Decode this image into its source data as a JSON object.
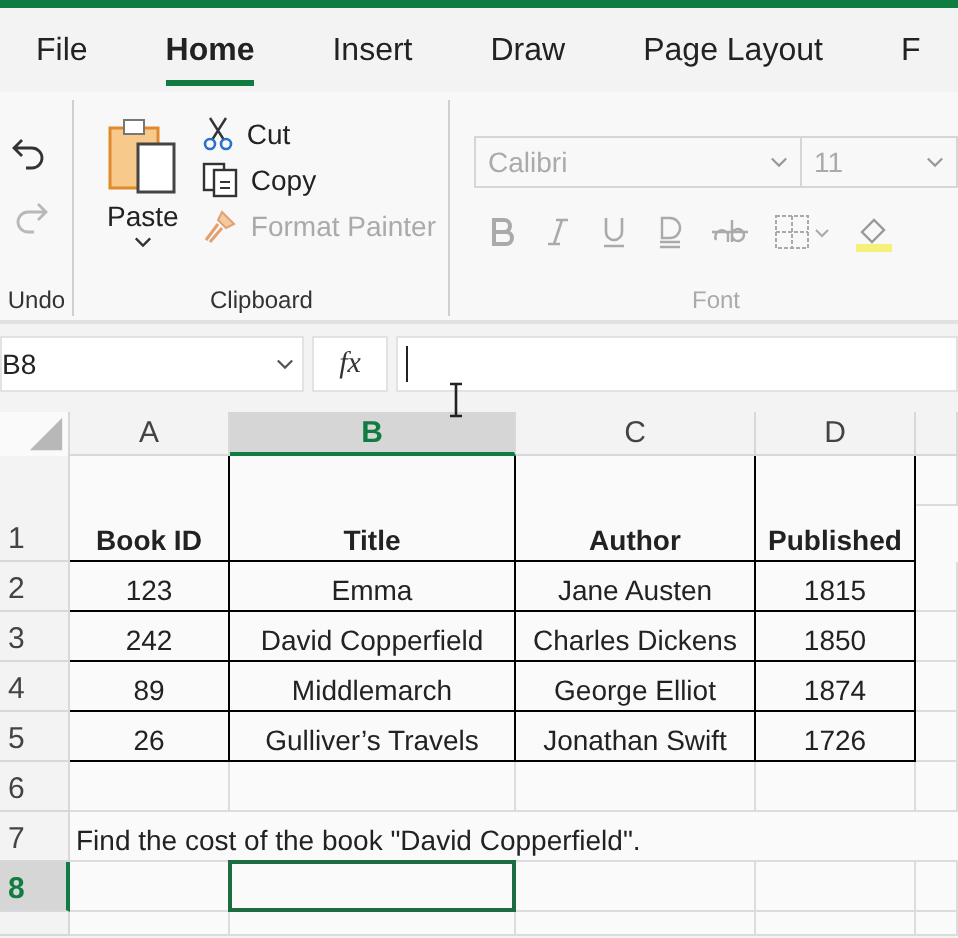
{
  "tabs": [
    {
      "label": "File",
      "selected": false
    },
    {
      "label": "Home",
      "selected": true
    },
    {
      "label": "Insert",
      "selected": false
    },
    {
      "label": "Draw",
      "selected": false
    },
    {
      "label": "Page Layout",
      "selected": false
    },
    {
      "label": "F",
      "selected": false
    }
  ],
  "ribbon": {
    "undo_group": {
      "label": "Undo",
      "undo": {
        "disabled": false
      },
      "redo": {
        "disabled": true
      }
    },
    "clipboard": {
      "label": "Clipboard",
      "paste": "Paste",
      "items": [
        {
          "label": "Cut",
          "disabled": false
        },
        {
          "label": "Copy",
          "disabled": false
        },
        {
          "label": "Format Painter",
          "disabled": true
        }
      ]
    },
    "font": {
      "label": "Font",
      "font_name": "Calibri",
      "font_size": "11",
      "disabled": true
    }
  },
  "formula_bar": {
    "name_box": "B8",
    "fx": "fx"
  },
  "columns": [
    {
      "label": "A",
      "selected": false
    },
    {
      "label": "B",
      "selected": true
    },
    {
      "label": "C",
      "selected": false
    },
    {
      "label": "D",
      "selected": false
    }
  ],
  "rows": [
    {
      "number": "1",
      "selected": false,
      "kind": "table_header",
      "cells": [
        "Book ID",
        "Title",
        "Author",
        "Published"
      ]
    },
    {
      "number": "2",
      "selected": false,
      "kind": "table",
      "cells": [
        "123",
        "Emma",
        "Jane Austen",
        "1815"
      ]
    },
    {
      "number": "3",
      "selected": false,
      "kind": "table",
      "cells": [
        "242",
        "David Copperfield",
        "Charles Dickens",
        "1850"
      ]
    },
    {
      "number": "4",
      "selected": false,
      "kind": "table",
      "cells": [
        "89",
        "Middlemarch",
        "George Elliot",
        "1874"
      ]
    },
    {
      "number": "5",
      "selected": false,
      "kind": "table",
      "cells": [
        "26",
        "Gulliver’s Travels",
        "Jonathan Swift",
        "1726"
      ]
    },
    {
      "number": "6",
      "selected": false,
      "kind": "empty"
    },
    {
      "number": "7",
      "selected": false,
      "kind": "note",
      "text": "Find the cost of the book \"David Copperfield\"."
    },
    {
      "number": "8",
      "selected": true,
      "kind": "empty"
    }
  ]
}
